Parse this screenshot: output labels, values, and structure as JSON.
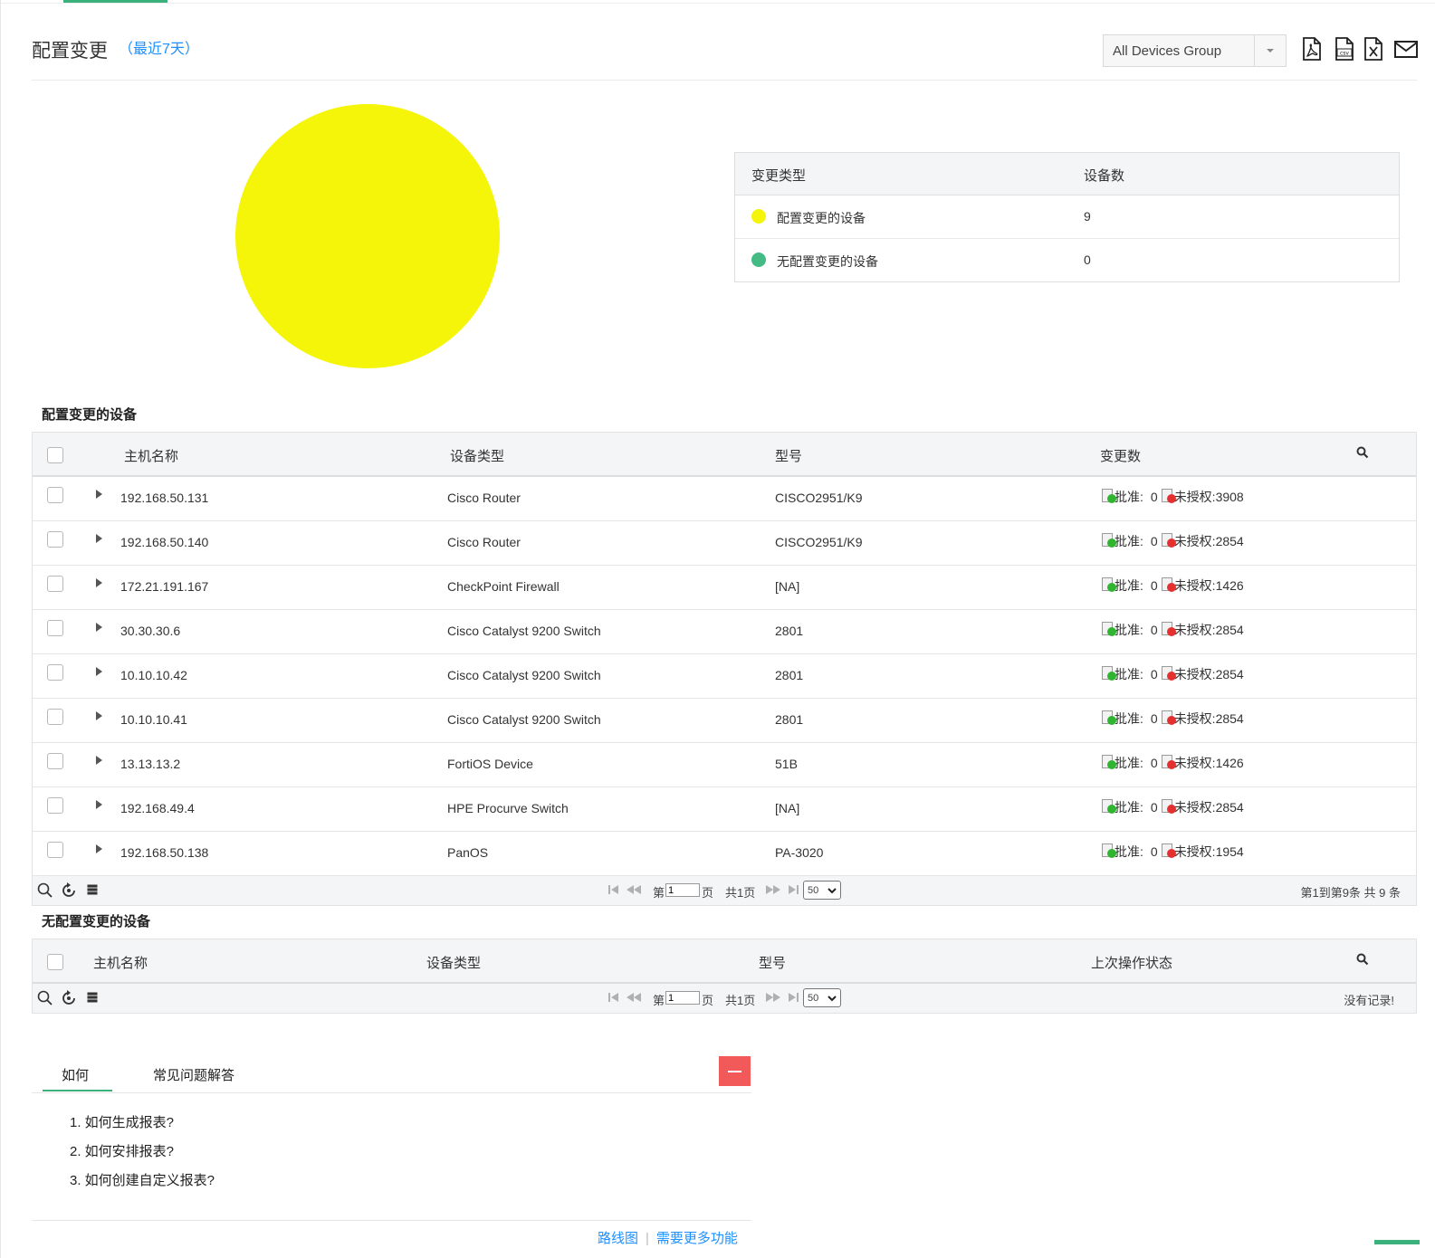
{
  "header": {
    "title": "配置变更",
    "subtitle": "（最近7天）",
    "group_select": "All Devices Group",
    "export_icons": [
      "pdf-icon",
      "csv-icon",
      "excel-icon",
      "email-icon"
    ]
  },
  "chart_data": {
    "type": "pie",
    "categories": [
      "配置变更的设备",
      "无配置变更的设备"
    ],
    "values": [
      9,
      0
    ],
    "colors": [
      "#f5f50a",
      "#44bb84"
    ]
  },
  "summary": {
    "col_type": "变更类型",
    "col_count": "设备数",
    "rows": [
      {
        "label": "配置变更的设备",
        "count": "9",
        "color": "#f5f50a"
      },
      {
        "label": "无配置变更的设备",
        "count": "0",
        "color": "#44bb84"
      }
    ]
  },
  "changed": {
    "title": "配置变更的设备",
    "columns": {
      "host": "主机名称",
      "type": "设备类型",
      "model": "型号",
      "changes": "变更数"
    },
    "approved_label": "批准:",
    "unauth_label": "未授权:",
    "rows": [
      {
        "host": "192.168.50.131",
        "type": "Cisco Router",
        "model": "CISCO2951/K9",
        "approved": "0",
        "unauth": "3908"
      },
      {
        "host": "192.168.50.140",
        "type": "Cisco Router",
        "model": "CISCO2951/K9",
        "approved": "0",
        "unauth": "2854"
      },
      {
        "host": "172.21.191.167",
        "type": "CheckPoint Firewall",
        "model": "[NA]",
        "approved": "0",
        "unauth": "1426"
      },
      {
        "host": "30.30.30.6",
        "type": "Cisco Catalyst 9200 Switch",
        "model": "2801",
        "approved": "0",
        "unauth": "2854"
      },
      {
        "host": "10.10.10.42",
        "type": "Cisco Catalyst 9200 Switch",
        "model": "2801",
        "approved": "0",
        "unauth": "2854"
      },
      {
        "host": "10.10.10.41",
        "type": "Cisco Catalyst 9200 Switch",
        "model": "2801",
        "approved": "0",
        "unauth": "2854"
      },
      {
        "host": "13.13.13.2",
        "type": "FortiOS Device",
        "model": "51B",
        "approved": "0",
        "unauth": "1426"
      },
      {
        "host": "192.168.49.4",
        "type": "HPE Procurve Switch",
        "model": "[NA]",
        "approved": "0",
        "unauth": "2854"
      },
      {
        "host": "192.168.50.138",
        "type": "PanOS",
        "model": "PA-3020",
        "approved": "0",
        "unauth": "1954"
      }
    ],
    "pager": {
      "page_prefix": "第",
      "page_value": "1",
      "page_suffix": "页",
      "total_pages": "共1页",
      "page_size": "50",
      "summary": "第1到第9条  共 9 条"
    }
  },
  "unchanged": {
    "title": "无配置变更的设备",
    "columns": {
      "host": "主机名称",
      "type": "设备类型",
      "model": "型号",
      "status": "上次操作状态"
    },
    "pager": {
      "page_prefix": "第",
      "page_value": "1",
      "page_suffix": "页",
      "total_pages": "共1页",
      "page_size": "50",
      "summary": "没有记录!"
    }
  },
  "help": {
    "tabs": [
      "如何",
      "常见问题解答"
    ],
    "items": [
      "1. 如何生成报表?",
      "2. 如何安排报表?",
      "3. 如何创建自定义报表?"
    ]
  },
  "footer": {
    "roadmap": "路线图",
    "more_features": "需要更多功能"
  }
}
